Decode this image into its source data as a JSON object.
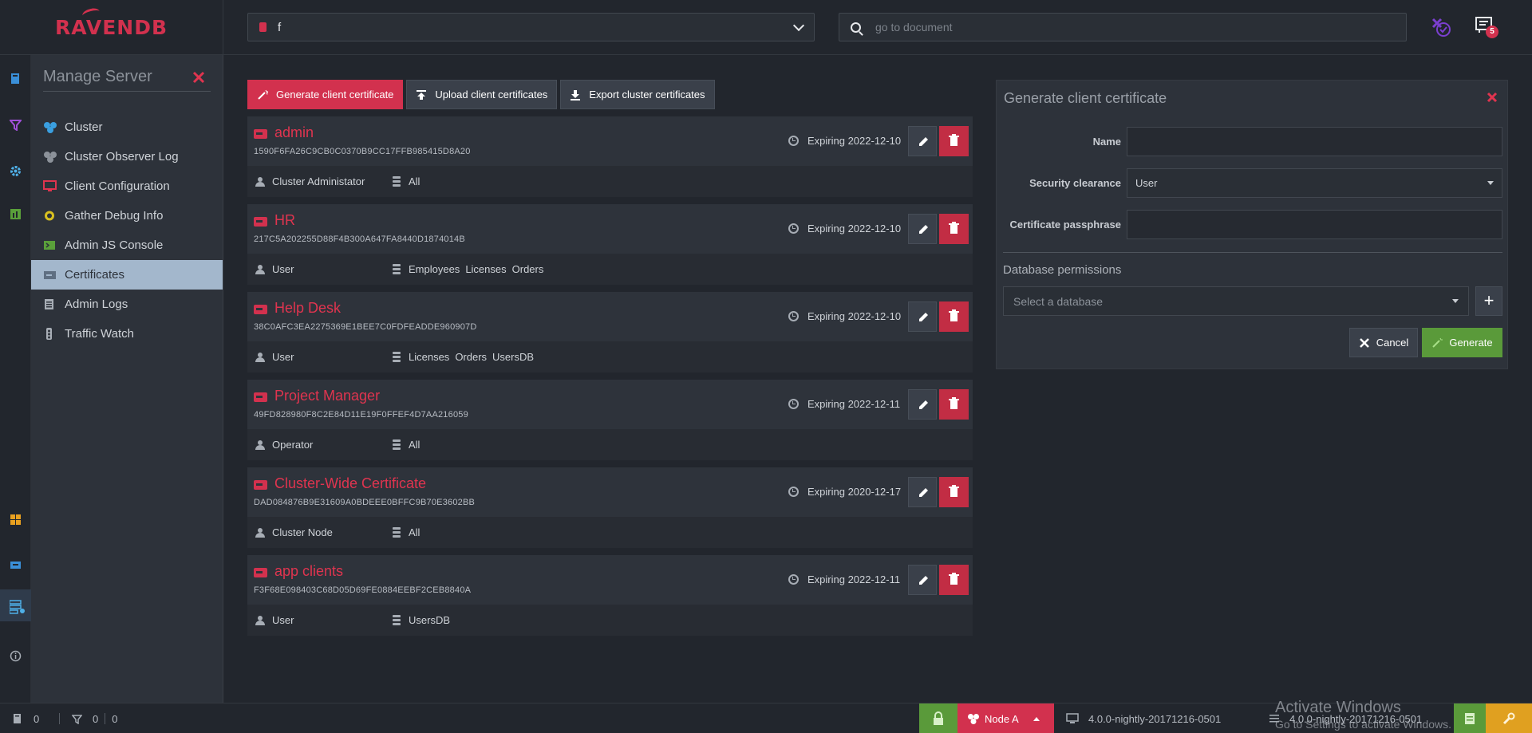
{
  "header": {
    "logo_text": "RAVENDB",
    "database_selector": {
      "value": "f"
    },
    "document_search": {
      "placeholder": "go to document"
    },
    "notifications_count": "5"
  },
  "sidebar": {
    "title": "Manage Server",
    "items": [
      {
        "label": "Cluster",
        "icon": "cluster-icon"
      },
      {
        "label": "Cluster Observer Log",
        "icon": "observer-icon"
      },
      {
        "label": "Client Configuration",
        "icon": "monitor-icon"
      },
      {
        "label": "Gather Debug Info",
        "icon": "debug-icon"
      },
      {
        "label": "Admin JS Console",
        "icon": "console-icon"
      },
      {
        "label": "Certificates",
        "icon": "certificate-icon",
        "active": true
      },
      {
        "label": "Admin Logs",
        "icon": "logs-icon"
      },
      {
        "label": "Traffic Watch",
        "icon": "traffic-icon"
      }
    ]
  },
  "toolbar": {
    "generate_label": "Generate client certificate",
    "upload_label": "Upload client certificates",
    "export_label": "Export cluster certificates"
  },
  "certificates": [
    {
      "name": "admin",
      "thumbprint": "1590F6FA26C9CB0C0370B9CC17FFB985415D8A20",
      "expiry": "Expiring 2022-12-10",
      "clearance": "Cluster Administator",
      "databases": [
        "All"
      ]
    },
    {
      "name": "HR",
      "thumbprint": "217C5A202255D88F4B300A647FA8440D1874014B",
      "expiry": "Expiring 2022-12-10",
      "clearance": "User",
      "databases": [
        "Employees",
        "Licenses",
        "Orders"
      ]
    },
    {
      "name": "Help Desk",
      "thumbprint": "38C0AFC3EA2275369E1BEE7C0FDFEADDE960907D",
      "expiry": "Expiring 2022-12-10",
      "clearance": "User",
      "databases": [
        "Licenses",
        "Orders",
        "UsersDB"
      ]
    },
    {
      "name": "Project Manager",
      "thumbprint": "49FD828980F8C2E84D11E19F0FFEF4D7AA216059",
      "expiry": "Expiring 2022-12-11",
      "clearance": "Operator",
      "databases": [
        "All"
      ]
    },
    {
      "name": "Cluster-Wide Certificate",
      "thumbprint": "DAD084876B9E31609A0BDEEE0BFFC9B70E3602BB",
      "expiry": "Expiring 2020-12-17",
      "clearance": "Cluster Node",
      "databases": [
        "All"
      ]
    },
    {
      "name": "app clients",
      "thumbprint": "F3F68E098403C68D05D69FE0884EEBF2CEB8840A",
      "expiry": "Expiring 2022-12-11",
      "clearance": "User",
      "databases": [
        "UsersDB"
      ]
    }
  ],
  "generate_panel": {
    "title": "Generate client certificate",
    "name_label": "Name",
    "name_value": "",
    "clearance_label": "Security clearance",
    "clearance_value": "User",
    "passphrase_label": "Certificate passphrase",
    "passphrase_value": "",
    "permissions_title": "Database permissions",
    "permissions_placeholder": "Select a database",
    "add_label": "+",
    "cancel_label": "Cancel",
    "generate_label": "Generate"
  },
  "statusbar": {
    "docs_count": "0",
    "indexes_count": "0",
    "errors_count": "0",
    "node_label": "Node A",
    "version": "4.0.0-nightly-20171216-0501",
    "version_overlap": "4.0.0-nightly-20171216-0501",
    "watermark_title": "Activate Windows",
    "watermark_sub": "Go to Settings to activate Windows."
  },
  "colors": {
    "accent": "#d2314e",
    "success": "#5a9a3a",
    "warning": "#e0a020",
    "active_menu": "#a3b7cc"
  }
}
